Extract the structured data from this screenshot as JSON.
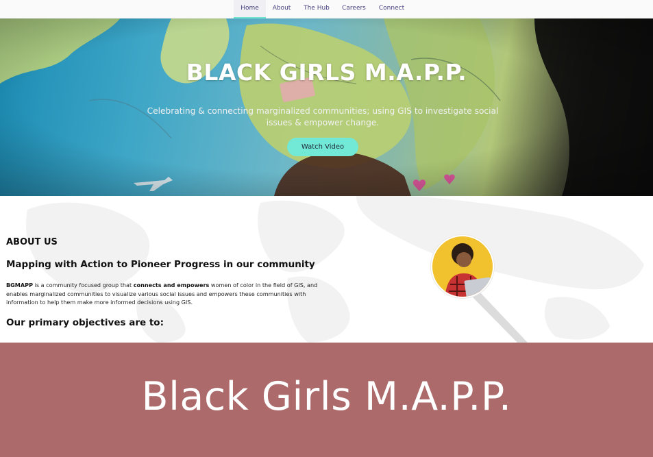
{
  "nav": {
    "items": [
      {
        "label": "Home",
        "active": true
      },
      {
        "label": "About",
        "active": false
      },
      {
        "label": "The Hub",
        "active": false
      },
      {
        "label": "Careers",
        "active": false
      },
      {
        "label": "Connect",
        "active": false
      }
    ]
  },
  "hero": {
    "title": "BLACK GIRLS M.A.P.P.",
    "subtitle": "Celebrating & connecting marginalized communities; using GIS to investigate social issues & empower change.",
    "button_label": "Watch Video",
    "button_color": "#72e8d6"
  },
  "about": {
    "heading": "ABOUT US",
    "tagline": "Mapping with Action to Pioneer Progress in our community",
    "paragraph": {
      "bold1": "BGMAPP",
      "text1": " is a community focused group that ",
      "bold2": "connects and empowers",
      "text2": " women of color in the field of GIS, and enables marginalized communities to visualize various social issues and empowers these communities with information to help them make more informed decisions using GIS."
    },
    "objectives_heading": "Our primary objectives are to:"
  },
  "banner": {
    "title": "Black Girls M.A.P.P.",
    "color": "#ad6a6b"
  }
}
